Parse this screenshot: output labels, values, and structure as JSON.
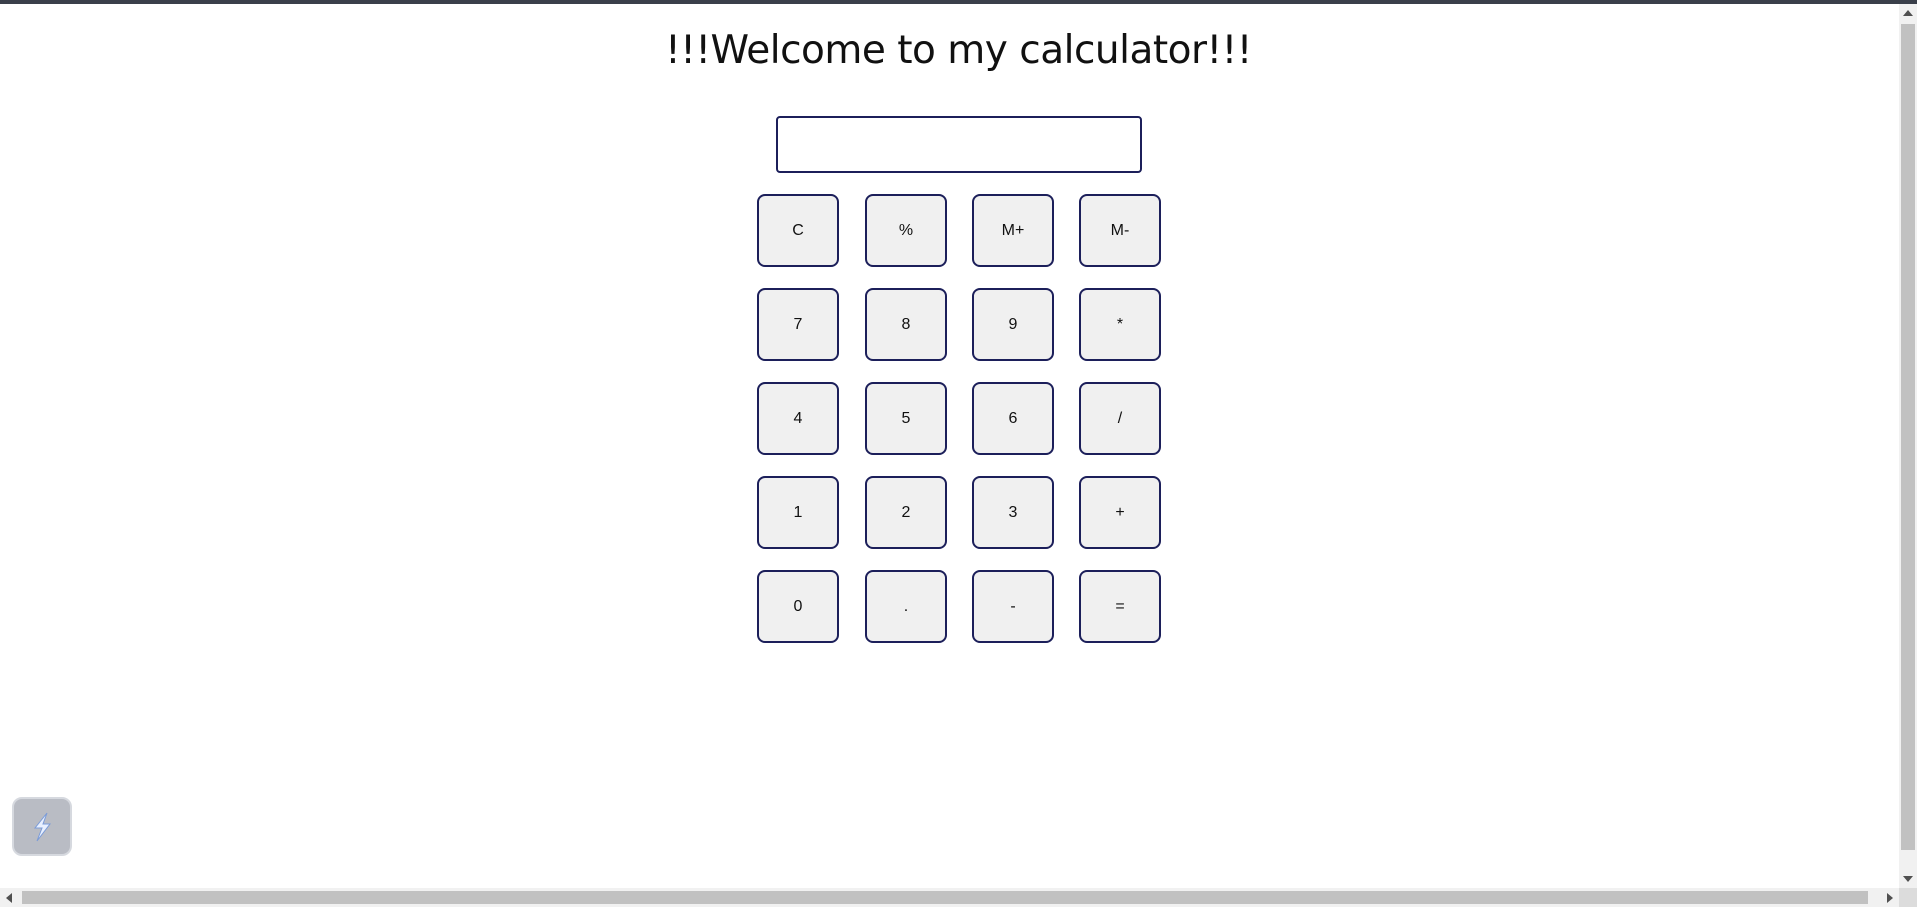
{
  "page": {
    "title": "!!!Welcome to my calculator!!!"
  },
  "display": {
    "value": "",
    "placeholder": ""
  },
  "keys": [
    [
      "C",
      "%",
      "M+",
      "M-"
    ],
    [
      "7",
      "8",
      "9",
      "*"
    ],
    [
      "4",
      "5",
      "6",
      "/"
    ],
    [
      "1",
      "2",
      "3",
      "+"
    ],
    [
      "0",
      ".",
      "-",
      "="
    ]
  ],
  "key_names": [
    [
      "clear-button",
      "percent-button",
      "memory-add-button",
      "memory-subtract-button"
    ],
    [
      "digit-7-button",
      "digit-8-button",
      "digit-9-button",
      "multiply-button"
    ],
    [
      "digit-4-button",
      "digit-5-button",
      "digit-6-button",
      "divide-button"
    ],
    [
      "digit-1-button",
      "digit-2-button",
      "digit-3-button",
      "add-button"
    ],
    [
      "digit-0-button",
      "decimal-point-button",
      "subtract-button",
      "equals-button"
    ]
  ],
  "widget": {
    "icon": "lightning-bolt-icon"
  },
  "colors": {
    "border": "#1c1f5a",
    "key_background": "#f0f0f0",
    "topbar": "#3a3f4a"
  }
}
